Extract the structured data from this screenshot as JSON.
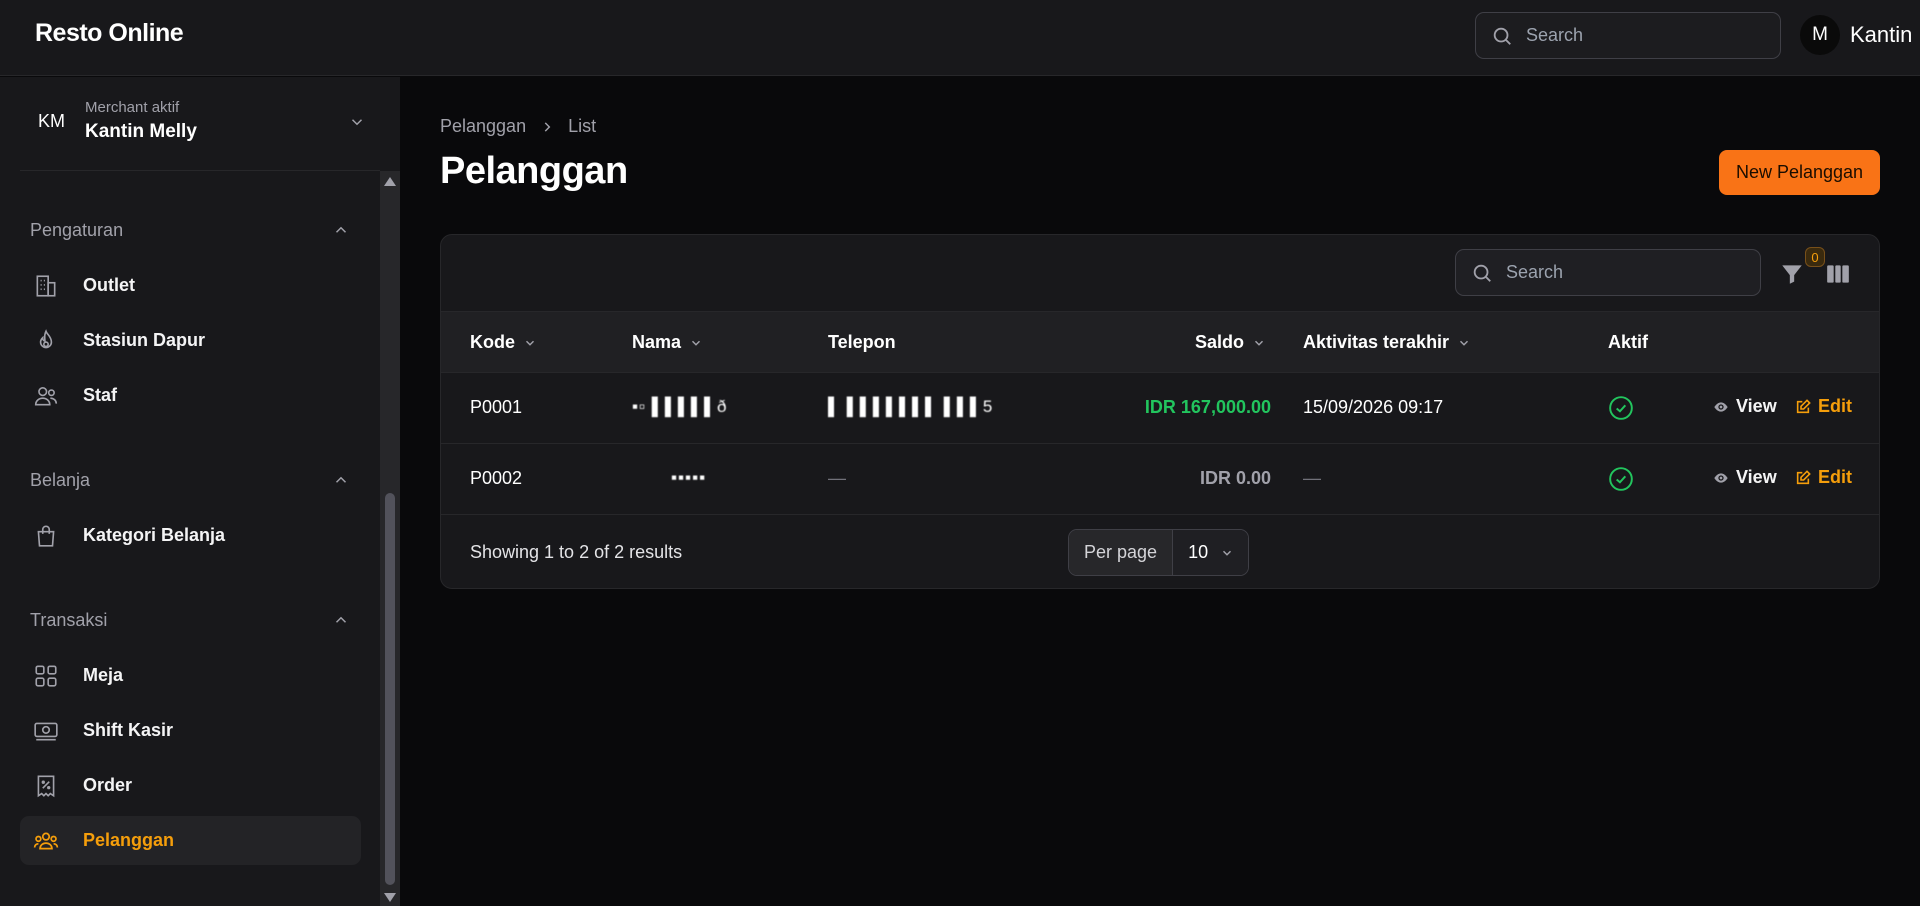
{
  "app": {
    "brand": "Resto Online"
  },
  "topbar": {
    "search_placeholder": "Search",
    "user": {
      "initial": "M",
      "name": "Kantin"
    }
  },
  "sidebar": {
    "merchant": {
      "initials": "KM",
      "label": "Merchant aktif",
      "name": "Kantin Melly"
    },
    "groups": [
      {
        "title": "Pengaturan",
        "items": [
          {
            "label": "Outlet",
            "icon": "building-icon"
          },
          {
            "label": "Stasiun Dapur",
            "icon": "fire-icon"
          },
          {
            "label": "Staf",
            "icon": "users-icon"
          }
        ]
      },
      {
        "title": "Belanja",
        "items": [
          {
            "label": "Kategori Belanja",
            "icon": "shopping-bag-icon"
          }
        ]
      },
      {
        "title": "Transaksi",
        "items": [
          {
            "label": "Meja",
            "icon": "grid-icon"
          },
          {
            "label": "Shift Kasir",
            "icon": "cash-icon"
          },
          {
            "label": "Order",
            "icon": "receipt-icon"
          },
          {
            "label": "Pelanggan",
            "icon": "user-group-icon",
            "active": true
          }
        ]
      }
    ]
  },
  "main": {
    "breadcrumbs": [
      "Pelanggan",
      "List"
    ],
    "title": "Pelanggan",
    "new_button": "New Pelanggan",
    "table": {
      "search_placeholder": "Search",
      "filter_count": "0",
      "columns": [
        "Kode",
        "Nama",
        "Telepon",
        "Saldo",
        "Aktivitas terakhir",
        "Aktif"
      ],
      "rows": [
        {
          "kode": "P0001",
          "nama": "▪▫ ▌▌▌▌▌ð",
          "telepon": "▌ ▌▌▌▌▌▌▌ ▌▌▌5",
          "saldo": "IDR 167,000.00",
          "aktivitas": "15/09/2026 09:17",
          "aktif": true,
          "view": "View",
          "edit": "Edit"
        },
        {
          "kode": "P0002",
          "nama": "▪▪▪▪▪",
          "telepon": "—",
          "saldo": "IDR 0.00",
          "aktivitas": "—",
          "aktif": true,
          "view": "View",
          "edit": "Edit"
        }
      ],
      "showing": "Showing 1 to 2 of 2 results",
      "per_page_label": "Per page",
      "per_page_value": "10"
    }
  },
  "colors": {
    "accent": "#f97316",
    "active_text": "#f59e0b",
    "success": "#22c55e"
  }
}
